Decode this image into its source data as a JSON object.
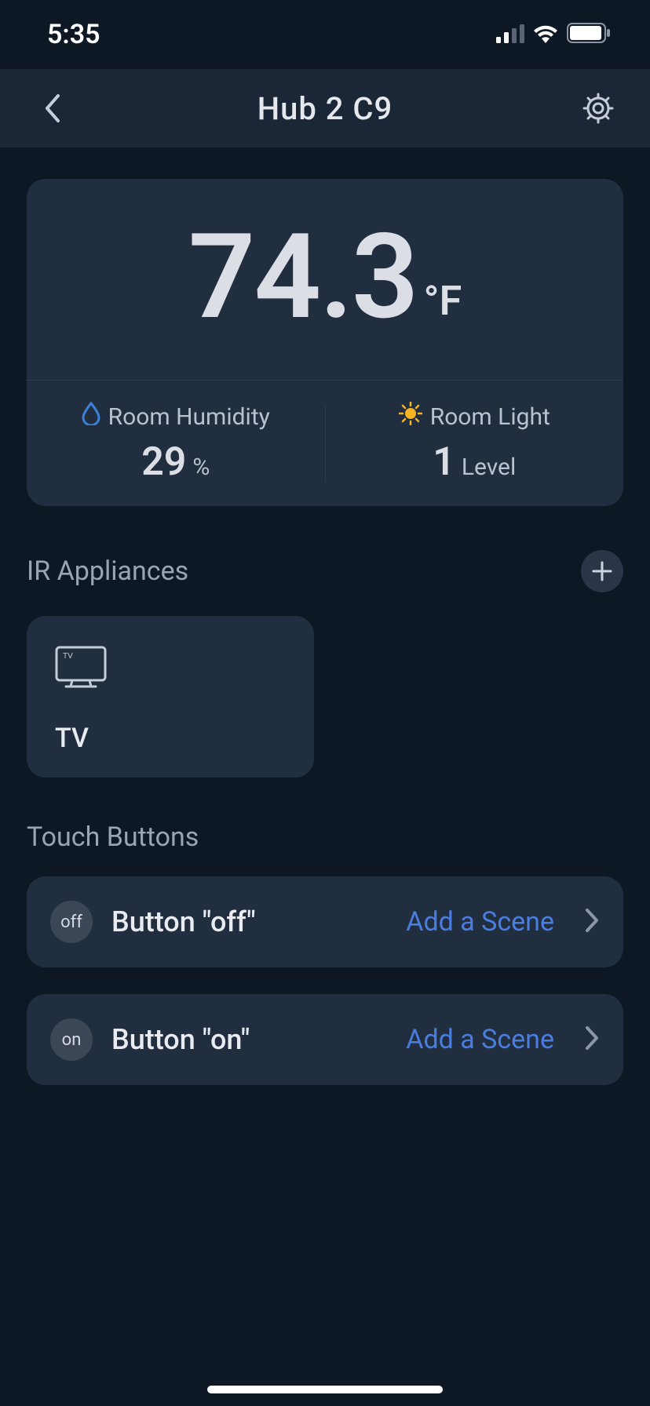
{
  "status": {
    "time": "5:35"
  },
  "nav": {
    "title": "Hub 2 C9"
  },
  "climate": {
    "temperature": "74.3",
    "temp_unit": "°F",
    "humidity": {
      "label": "Room Humidity",
      "value": "29",
      "unit": "%"
    },
    "light": {
      "label": "Room Light",
      "value": "1",
      "unit": "Level"
    }
  },
  "sections": {
    "ir": {
      "title": "IR Appliances"
    },
    "touch": {
      "title": "Touch Buttons"
    }
  },
  "appliances": [
    {
      "name": "TV"
    }
  ],
  "touch_buttons": [
    {
      "tag": "off",
      "label": "Button \"off\"",
      "action": "Add a Scene"
    },
    {
      "tag": "on",
      "label": "Button \"on\"",
      "action": "Add a Scene"
    }
  ]
}
